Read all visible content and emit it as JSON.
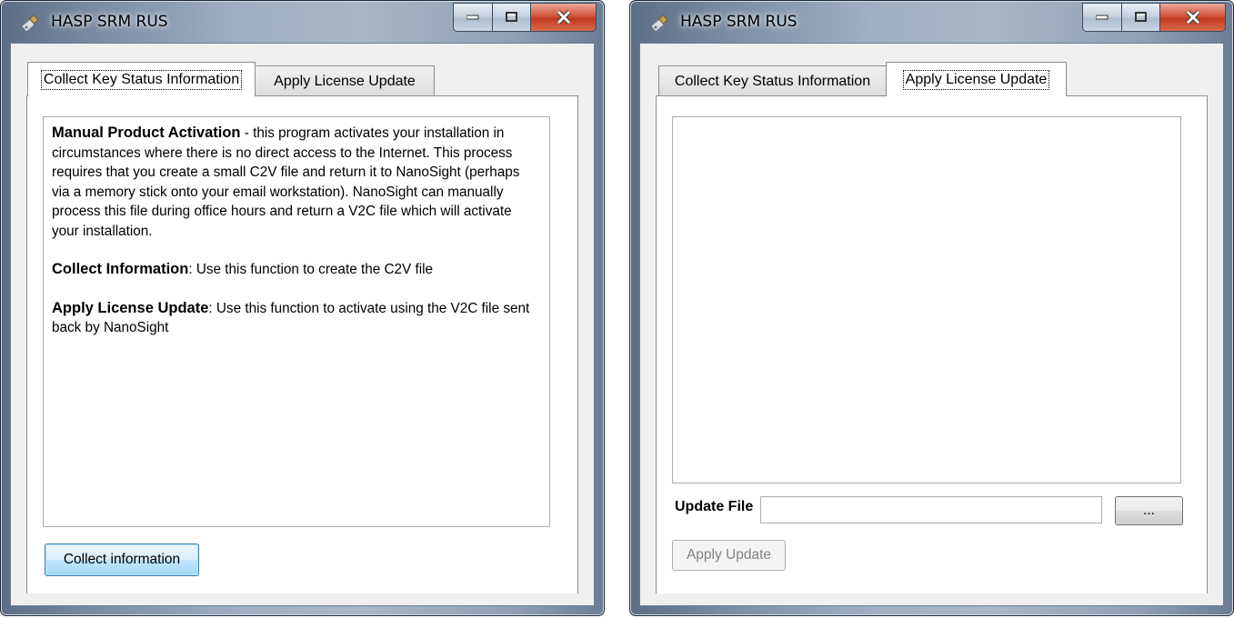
{
  "windows": [
    {
      "title": "HASP SRM RUS",
      "tabs": [
        {
          "label": "Collect Key Status Information",
          "active": true
        },
        {
          "label": "Apply License Update",
          "active": false
        }
      ],
      "intro": {
        "heading": "Manual Product Activation",
        "text": " - this program activates your installation in circumstances where there is no direct access to the Internet. This process requires that you create a small C2V file and return it to NanoSight (perhaps via a memory stick onto your email workstation). NanoSight can manually process this file during office hours and return a V2C file which will activate your installation."
      },
      "collect_info": {
        "heading": "Collect Information",
        "text": ": Use this function to create the C2V file"
      },
      "apply_update": {
        "heading": "Apply License Update",
        "text": ": Use this function to activate using the V2C file sent back by NanoSight"
      },
      "collect_button": "Collect information"
    },
    {
      "title": "HASP SRM RUS",
      "tabs": [
        {
          "label": "Collect Key Status Information",
          "active": false
        },
        {
          "label": "Apply License Update",
          "active": true
        }
      ],
      "update_file_label": "Update File",
      "update_file_value": "",
      "browse_button": "...",
      "apply_button": "Apply Update"
    }
  ],
  "colors": {
    "title_gradient_dark": "#5b6e86",
    "client_bg": "#f0f0f0",
    "close_red": "#c23a1f",
    "focus_blue": "#3c7fb1"
  },
  "icons": [
    "usb-key-icon",
    "minimize-icon",
    "maximize-icon",
    "close-icon"
  ]
}
